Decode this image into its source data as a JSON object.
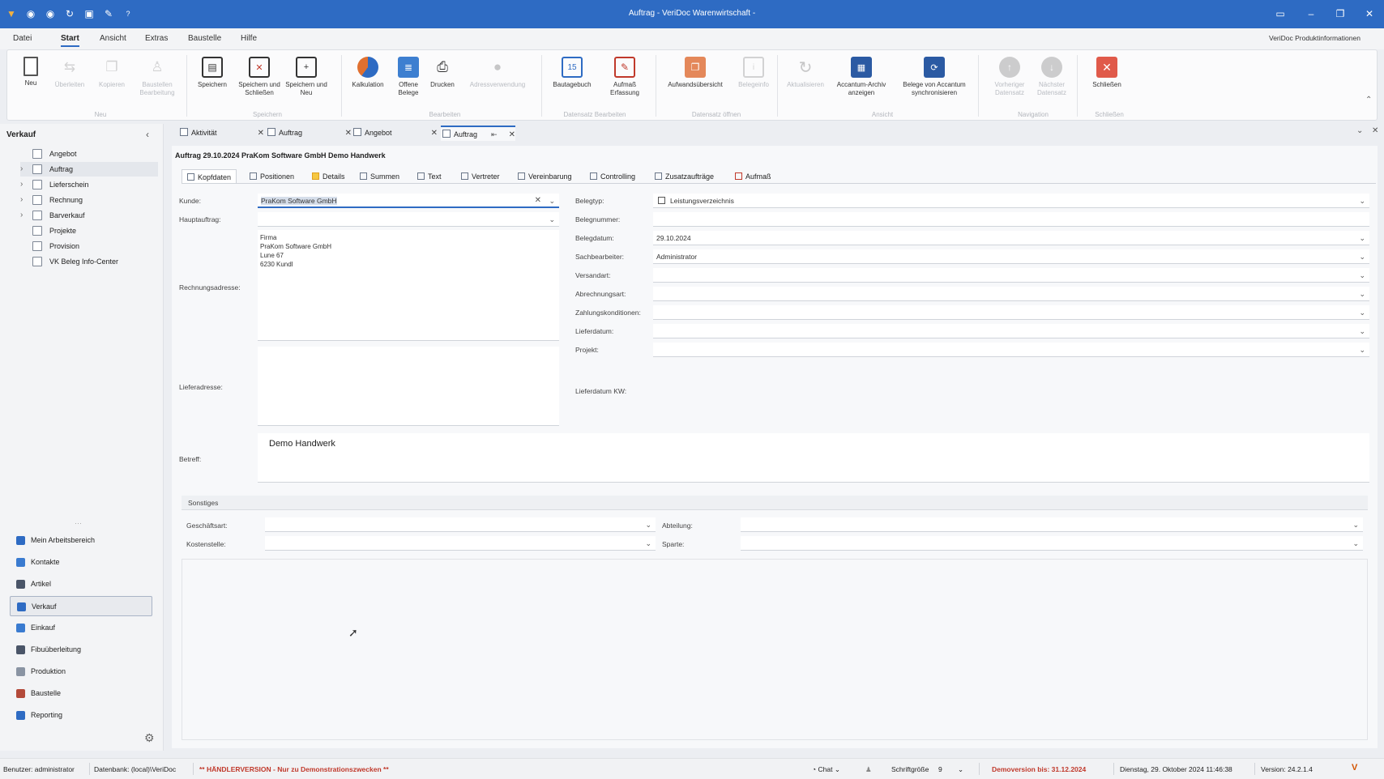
{
  "titlebar": {
    "title": "Auftrag - VeriDoc Warenwirtschaft -",
    "qa_icons": [
      "app-icon",
      "back-icon",
      "forward-icon",
      "refresh-icon",
      "save-icon",
      "edit-icon",
      "help-icon"
    ],
    "window_controls": [
      "ribbon-toggle-icon",
      "minimize-icon",
      "restore-icon",
      "close-icon"
    ]
  },
  "menubar": {
    "items": [
      "Datei",
      "Start",
      "Ansicht",
      "Extras",
      "Baustelle",
      "Hilfe"
    ],
    "active": "Start",
    "right_link": "VeriDoc Produktinformationen"
  },
  "ribbon": {
    "buttons": [
      {
        "label": "Neu",
        "icon": "new-doc-icon"
      },
      {
        "label": "Überleiten",
        "icon": "transfer-icon"
      },
      {
        "label": "Kopieren",
        "icon": "copy-icon"
      },
      {
        "label": "Baustellen Bearbeitung",
        "icon": "worker-icon"
      },
      {
        "label": "Speichern",
        "icon": "save-icon"
      },
      {
        "label": "Speichern und Schließen",
        "icon": "save-close-icon"
      },
      {
        "label": "Speichern und Neu",
        "icon": "save-new-icon"
      },
      {
        "label": "Kalkulation",
        "icon": "pie-chart-icon"
      },
      {
        "label": "Offene Belege",
        "icon": "open-docs-icon"
      },
      {
        "label": "Drucken",
        "icon": "print-icon"
      },
      {
        "label": "Adressverwendung",
        "icon": "person-icon"
      },
      {
        "label": "Bautagebuch",
        "icon": "calendar-icon"
      },
      {
        "label": "Aufmaß Erfassung",
        "icon": "measure-icon"
      },
      {
        "label": "Aufwandsübersicht",
        "icon": "effort-icon"
      },
      {
        "label": "Belegeinfo",
        "icon": "info-doc-icon"
      },
      {
        "label": "Aktualisieren",
        "icon": "refresh-icon"
      },
      {
        "label": "Accantum-Archiv anzeigen",
        "icon": "archive-icon"
      },
      {
        "label": "Belege von Accantum synchronisieren",
        "icon": "sync-icon"
      },
      {
        "label": "Vorheriger Datensatz",
        "icon": "up-icon"
      },
      {
        "label": "Nächster Datensatz",
        "icon": "down-icon"
      },
      {
        "label": "Schließen",
        "icon": "close-red-icon"
      }
    ],
    "groups": [
      "Neu",
      "Speichern",
      "Bearbeiten",
      "Datensatz Bearbeiten",
      "Datensatz öffnen",
      "Ansicht",
      "Navigation",
      "Schließen"
    ]
  },
  "leftnav": {
    "header": "Verkauf",
    "tree": [
      "Angebot",
      "Auftrag",
      "Lieferschein",
      "Rechnung",
      "Barverkauf",
      "Projekte",
      "Provision",
      "VK Beleg Info-Center"
    ],
    "modules": [
      "Mein Arbeitsbereich",
      "Kontakte",
      "Artikel",
      "Verkauf",
      "Einkauf",
      "Fibuüberleitung",
      "Produktion",
      "Baustelle",
      "Reporting"
    ]
  },
  "doctabs": [
    "Aktivität",
    "Auftrag",
    "Angebot",
    "Auftrag"
  ],
  "form": {
    "title": "Auftrag 29.10.2024 PraKom Software GmbH Demo Handwerk",
    "subtabs": [
      "Kopfdaten",
      "Positionen",
      "Details",
      "Summen",
      "Text",
      "Vertreter",
      "Vereinbarung",
      "Controlling",
      "Zusatzaufträge",
      "Aufmaß"
    ],
    "labels": {
      "kunde": "Kunde:",
      "hauptauftrag": "Hauptauftrag:",
      "rechnungsadresse": "Rechnungsadresse:",
      "lieferadresse": "Lieferadresse:",
      "betreff": "Betreff:",
      "belegtyp": "Belegtyp:",
      "belegnummer": "Belegnummer:",
      "belegdatum": "Belegdatum:",
      "sachbearbeiter": "Sachbearbeiter:",
      "versandart": "Versandart:",
      "abrechnungsart": "Abrechnungsart:",
      "zahlungskonditionen": "Zahlungskonditionen:",
      "lieferdatum": "Lieferdatum:",
      "projekt": "Projekt:",
      "lieferdatum_kw": "Lieferdatum KW:"
    },
    "values": {
      "kunde": "PraKom Software GmbH",
      "belegtyp": "Leistungsverzeichnis",
      "belegdatum": "29.10.2024",
      "sachbearbeiter": "Administrator",
      "betreff": "Demo Handwerk",
      "address_lines": [
        "Firma",
        "PraKom Software GmbH",
        "Lune 67",
        "6230 Kundl"
      ]
    },
    "sonstiges": {
      "header": "Sonstiges",
      "labels": {
        "geschaeftsart": "Geschäftsart:",
        "kostenstelle": "Kostenstelle:",
        "abteilung": "Abteilung:",
        "sparte": "Sparte:"
      }
    }
  },
  "statusbar": {
    "user": "Benutzer: administrator",
    "db": "Datenbank: (local)\\VeriDoc",
    "warning": "** HÄNDLERVERSION - Nur zu Demonstrationszwecken **",
    "chat": "Chat",
    "fontsize_label": "Schriftgröße",
    "fontsize_value": "9",
    "demo": "Demoversion bis: 31.12.2024",
    "datetime": "Dienstag, 29. Oktober 2024 11:46:38",
    "version": "Version: 24.2.1.4"
  },
  "colors": {
    "titlebar": "#2e6bc3",
    "warning": "#c0392b",
    "accent": "#2e6bc3"
  }
}
